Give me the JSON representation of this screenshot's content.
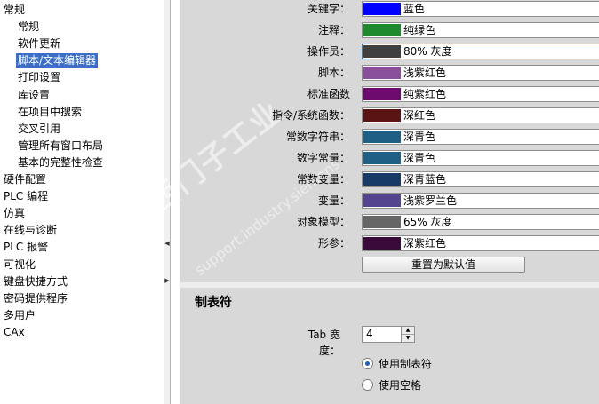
{
  "nav": {
    "items": [
      {
        "label": "常规",
        "level": 0
      },
      {
        "label": "常规",
        "level": 1
      },
      {
        "label": "软件更新",
        "level": 1
      },
      {
        "label": "脚本/文本编辑器",
        "level": 1,
        "selected": true
      },
      {
        "label": "打印设置",
        "level": 1
      },
      {
        "label": "库设置",
        "level": 1
      },
      {
        "label": "在项目中搜索",
        "level": 1
      },
      {
        "label": "交叉引用",
        "level": 1
      },
      {
        "label": "管理所有窗口布局",
        "level": 1
      },
      {
        "label": "基本的完整性检查",
        "level": 1
      },
      {
        "label": "硬件配置",
        "level": 0
      },
      {
        "label": "PLC 编程",
        "level": 0
      },
      {
        "label": "仿真",
        "level": 0
      },
      {
        "label": "在线与诊断",
        "level": 0
      },
      {
        "label": "PLC 报警",
        "level": 0
      },
      {
        "label": "可视化",
        "level": 0
      },
      {
        "label": "键盘快捷方式",
        "level": 0
      },
      {
        "label": "密码提供程序",
        "level": 0
      },
      {
        "label": "多用户",
        "level": 0
      },
      {
        "label": "CAx",
        "level": 0
      }
    ]
  },
  "splitter": {
    "arrow_left": "◀",
    "arrow_right": "▶"
  },
  "colors": {
    "rows": [
      {
        "label": "关键字：",
        "value": "蓝色",
        "swatch": "#0000ff"
      },
      {
        "label": "注释：",
        "value": "纯绿色",
        "swatch": "#1e8a2e"
      },
      {
        "label": "操作员：",
        "value": "80% 灰度",
        "swatch": "#404040"
      },
      {
        "label": "脚本：",
        "value": "浅紫红色",
        "swatch": "#8a4f9a"
      },
      {
        "label": "标准函数",
        "value": "纯紫红色",
        "swatch": "#6b0b6e"
      },
      {
        "label": "指令/系统函数：",
        "value": "深红色",
        "swatch": "#5a1414"
      },
      {
        "label": "常数字符串：",
        "value": "深青色",
        "swatch": "#1f5f86"
      },
      {
        "label": "数字常量：",
        "value": "深青色",
        "swatch": "#1f5f86"
      },
      {
        "label": "常数变量：",
        "value": "深青蓝色",
        "swatch": "#173a66"
      },
      {
        "label": "变量：",
        "value": "浅紫罗兰色",
        "swatch": "#54448f"
      },
      {
        "label": "对象模型：",
        "value": "65% 灰度",
        "swatch": "#666666"
      },
      {
        "label": "形参：",
        "value": "深紫红色",
        "swatch": "#3a0a3a"
      }
    ],
    "reset_button": "重置为默认值"
  },
  "tabs_section": {
    "title": "制表符",
    "tab_width_label": "Tab 宽度：",
    "tab_width_value": "4",
    "options": [
      {
        "label": "使用制表符",
        "checked": true
      },
      {
        "label": "使用空格",
        "checked": false
      }
    ]
  }
}
